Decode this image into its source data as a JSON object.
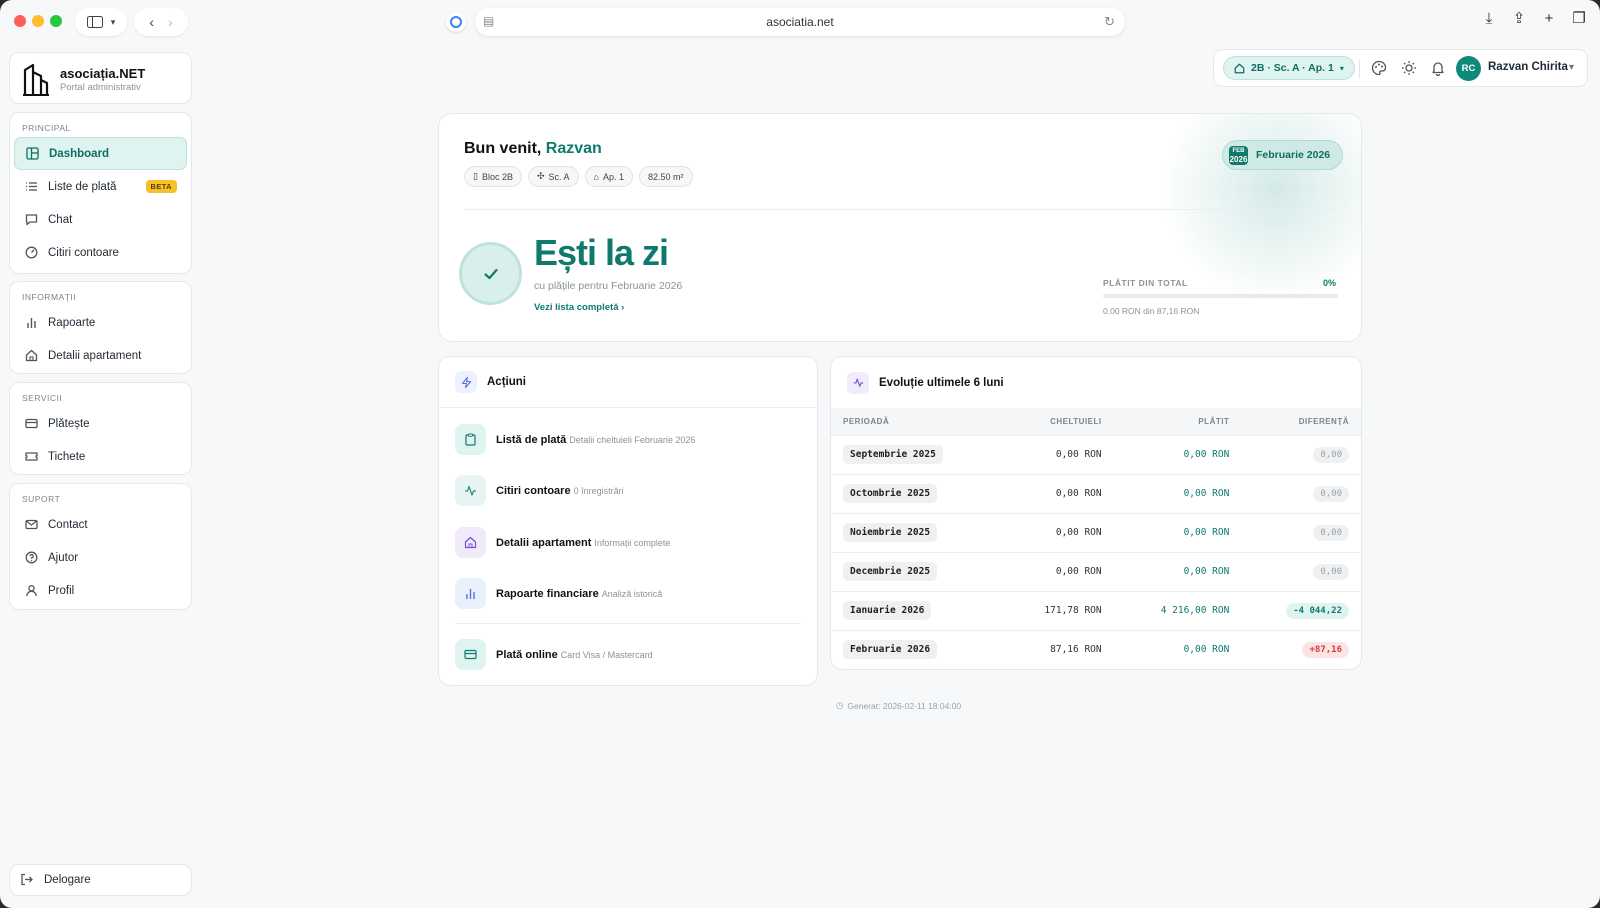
{
  "browser": {
    "url": "asociatia.net"
  },
  "brand": {
    "name": "asociația.NET",
    "subtitle": "Portal administrativ"
  },
  "sidebar": {
    "groups": [
      {
        "title": "PRINCIPAL",
        "items": [
          {
            "label": "Dashboard",
            "icon": "layout-icon",
            "active": true
          },
          {
            "label": "Liste de plată",
            "icon": "list-icon",
            "badge": "BETA"
          },
          {
            "label": "Chat",
            "icon": "chat-icon"
          },
          {
            "label": "Citiri contoare",
            "icon": "gauge-icon"
          }
        ]
      },
      {
        "title": "INFORMAȚII",
        "items": [
          {
            "label": "Rapoarte",
            "icon": "bar-chart-icon"
          },
          {
            "label": "Detalii apartament",
            "icon": "home-icon"
          }
        ]
      },
      {
        "title": "SERVICII",
        "items": [
          {
            "label": "Plătește",
            "icon": "card-icon"
          },
          {
            "label": "Tichete",
            "icon": "ticket-icon"
          }
        ]
      },
      {
        "title": "SUPORT",
        "items": [
          {
            "label": "Contact",
            "icon": "mail-icon"
          },
          {
            "label": "Ajutor",
            "icon": "help-icon"
          },
          {
            "label": "Profil",
            "icon": "user-icon"
          }
        ]
      }
    ],
    "logout": "Delogare"
  },
  "topbar": {
    "apartment_selector": "2B · Sc. A · Ap. 1",
    "avatar_initials": "RC",
    "user_name": "Razvan Chirita"
  },
  "hero": {
    "welcome_prefix": "Bun venit,",
    "welcome_name": "Razvan",
    "chips": [
      "Bloc 2B",
      "Sc. A",
      "Ap. 1",
      "82.50 m²"
    ],
    "calendar_month": "FEB",
    "calendar_year": "2026",
    "month_label": "Februarie 2026",
    "status_title": "Ești la zi",
    "status_subtitle": "cu plățile pentru Februarie 2026",
    "see_list_link": "Vezi lista completă",
    "paid_label": "PLĂTIT DIN TOTAL",
    "paid_percent_text": "0%",
    "paid_fraction": 0,
    "paid_amount": "0,00 RON din 87,16 RON"
  },
  "actions": {
    "title": "Acțiuni",
    "items": [
      {
        "title": "Listă de plată",
        "desc": "Detalii cheltuieli Februarie 2026",
        "icon": "clipboard-icon"
      },
      {
        "title": "Citiri contoare",
        "desc": "0 înregistrări",
        "icon": "activity-icon"
      },
      {
        "title": "Detalii apartament",
        "desc": "Informații complete",
        "icon": "home-icon"
      },
      {
        "title": "Rapoarte financiare",
        "desc": "Analiză istorică",
        "icon": "bar-chart-icon"
      },
      {
        "title": "Plată online",
        "desc": "Card Visa / Mastercard",
        "icon": "card-icon"
      }
    ]
  },
  "evolution": {
    "title": "Evoluție ultimele 6 luni",
    "columns": [
      "PERIOADĂ",
      "CHELTUIELI",
      "PLĂTIT",
      "DIFERENȚĂ"
    ],
    "rows": [
      {
        "period": "Septembrie 2025",
        "expenses": "0,00 RON",
        "paid": "0,00 RON",
        "diff": "0,00",
        "kind": "neutral"
      },
      {
        "period": "Octombrie 2025",
        "expenses": "0,00 RON",
        "paid": "0,00 RON",
        "diff": "0,00",
        "kind": "neutral"
      },
      {
        "period": "Noiembrie 2025",
        "expenses": "0,00 RON",
        "paid": "0,00 RON",
        "diff": "0,00",
        "kind": "neutral"
      },
      {
        "period": "Decembrie 2025",
        "expenses": "0,00 RON",
        "paid": "0,00 RON",
        "diff": "0,00",
        "kind": "neutral"
      },
      {
        "period": "Ianuarie 2026",
        "expenses": "171,78 RON",
        "paid": "4 216,00 RON",
        "diff": "-4 044,22",
        "kind": "neg"
      },
      {
        "period": "Februarie 2026",
        "expenses": "87,16 RON",
        "paid": "0,00 RON",
        "diff": "+87,16",
        "kind": "pos"
      }
    ]
  },
  "footer": {
    "generated": "Generat: 2026-02-11 18:04:00"
  },
  "colors": {
    "accent": "#0f7a6c",
    "accent_light": "#dff3f0",
    "beta": "#f6c026",
    "negative": "#d23c3c"
  }
}
